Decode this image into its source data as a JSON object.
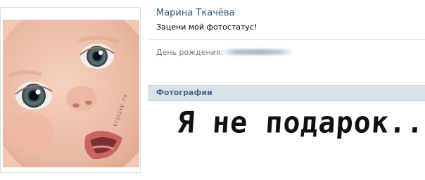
{
  "profile": {
    "name": "Марина Ткачёва",
    "status": "Зацени мой фотостатус!",
    "birthday_label": "День рождения:",
    "avatar": {
      "watermark": "trinixy.ru"
    }
  },
  "photos_section": {
    "title": "Фотографии",
    "photo_text": "Я не подарок..."
  },
  "colors": {
    "name_link": "#2b587a",
    "section_header_bg": "#dae2e8",
    "section_title": "#45688e",
    "label_gray": "#777777"
  }
}
